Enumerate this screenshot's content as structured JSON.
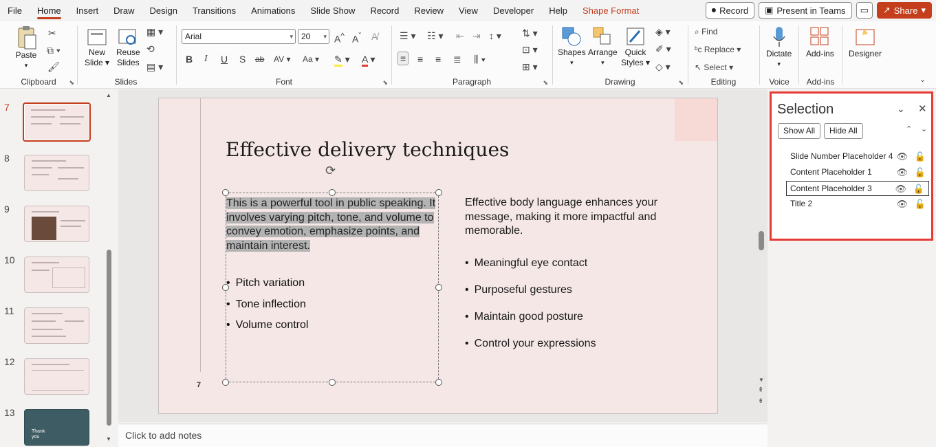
{
  "menu": {
    "tabs": [
      "File",
      "Home",
      "Insert",
      "Draw",
      "Design",
      "Transitions",
      "Animations",
      "Slide Show",
      "Record",
      "Review",
      "View",
      "Developer",
      "Help",
      "Shape Format"
    ],
    "record_label": "Record",
    "present_label": "Present in Teams",
    "share_label": "Share"
  },
  "ribbon": {
    "clipboard": {
      "label": "Clipboard",
      "paste": "Paste"
    },
    "slides": {
      "label": "Slides",
      "new_slide_1": "New",
      "new_slide_2": "Slide",
      "reuse_1": "Reuse",
      "reuse_2": "Slides"
    },
    "font": {
      "label": "Font",
      "family": "Arial",
      "size": "20"
    },
    "paragraph": {
      "label": "Paragraph"
    },
    "drawing": {
      "label": "Drawing",
      "shapes": "Shapes",
      "arrange": "Arrange",
      "quick_1": "Quick",
      "quick_2": "Styles"
    },
    "editing": {
      "label": "Editing",
      "find": "Find",
      "replace": "Replace",
      "select": "Select"
    },
    "voice": {
      "label": "Voice",
      "dictate": "Dictate"
    },
    "addins": {
      "label": "Add-ins",
      "addins": "Add-ins"
    },
    "designer": {
      "label": "Designer"
    }
  },
  "thumbnails": {
    "numbers": [
      "7",
      "8",
      "9",
      "10",
      "11",
      "12",
      "13"
    ],
    "slide13_text_1": "Thank",
    "slide13_text_2": "you"
  },
  "slide": {
    "title": "Effective delivery techniques",
    "number": "7",
    "left_paragraph": "This is a powerful tool in public speaking. It involves varying pitch, tone, and volume to convey emotion, emphasize points, and maintain interest.",
    "left_bullets": [
      "Pitch variation",
      "Tone inflection",
      "Volume control"
    ],
    "right_paragraph": "Effective body language enhances your message, making it more impactful and memorable.",
    "right_bullets": [
      "Meaningful eye contact",
      "Purposeful gestures",
      "Maintain good posture",
      "Control your expressions"
    ]
  },
  "notes": {
    "placeholder": "Click to add notes"
  },
  "selection_pane": {
    "title": "Selection",
    "show_all": "Show All",
    "hide_all": "Hide All",
    "items": [
      "Slide Number Placeholder 4",
      "Content Placeholder 1",
      "Content Placeholder 3",
      "Title 2"
    ],
    "focused_index": 2
  },
  "colors": {
    "accent": "#c43e1c",
    "highlight": "#e53935",
    "slide_bg": "#f4e7e5"
  }
}
